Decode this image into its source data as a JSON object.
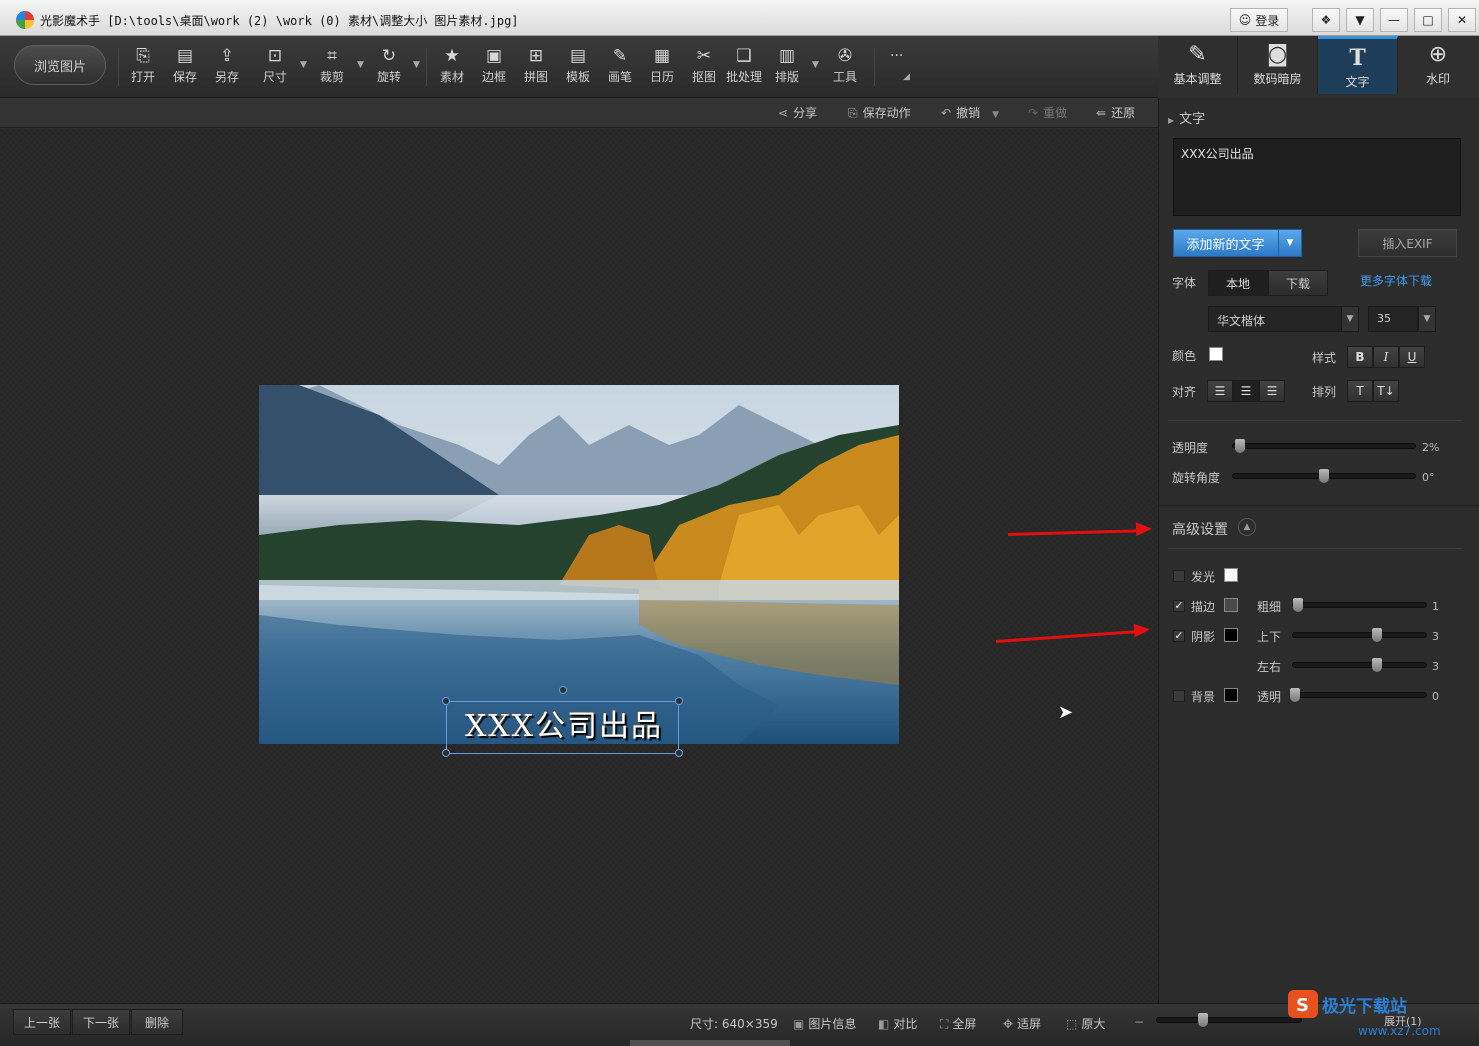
{
  "window": {
    "title": "光影魔术手 [D:\\tools\\桌面\\work (2) \\work (0) 素材\\调整大小 图片素材.jpg]",
    "login_label": "登录",
    "controls": [
      "❓",
      "▼",
      "—",
      "□",
      "✕"
    ]
  },
  "toolbar": {
    "browse_label": "浏览图片",
    "tools": [
      {
        "label": "打开",
        "icon": "open-icon"
      },
      {
        "label": "保存",
        "icon": "save-icon"
      },
      {
        "label": "另存",
        "icon": "save-as-icon"
      },
      {
        "label": "尺寸",
        "icon": "resize-icon"
      },
      {
        "label": "裁剪",
        "icon": "crop-icon"
      },
      {
        "label": "旋转",
        "icon": "rotate-icon"
      },
      {
        "label": "素材",
        "icon": "material-icon"
      },
      {
        "label": "边框",
        "icon": "border-icon"
      },
      {
        "label": "拼图",
        "icon": "collage-icon"
      },
      {
        "label": "模板",
        "icon": "template-icon"
      },
      {
        "label": "画笔",
        "icon": "brush-icon"
      },
      {
        "label": "日历",
        "icon": "calendar-icon"
      },
      {
        "label": "抠图",
        "icon": "cutout-icon"
      },
      {
        "label": "批处理",
        "icon": "batch-icon"
      },
      {
        "label": "排版",
        "icon": "layout-icon"
      },
      {
        "label": "工具",
        "icon": "tools-icon"
      }
    ],
    "more_label": "..."
  },
  "right_tabs": [
    {
      "label": "基本调整",
      "icon": "basic-adjust-icon"
    },
    {
      "label": "数码暗房",
      "icon": "darkroom-icon"
    },
    {
      "label": "文字",
      "icon": "text-tool-icon"
    },
    {
      "label": "水印",
      "icon": "watermark-icon"
    }
  ],
  "actions": {
    "share": "分享",
    "save_action": "保存动作",
    "undo": "撤销",
    "redo": "重做",
    "restore": "还原"
  },
  "canvas": {
    "overlay_text": "XXX公司出品"
  },
  "text_panel": {
    "section_title": "文字",
    "text_value": "XXX公司出品",
    "add_button": "添加新的文字",
    "insert_exif": "插入EXIF",
    "font_label": "字体",
    "font_tab_local": "本地",
    "font_tab_download": "下载",
    "more_fonts_link": "更多字体下载",
    "font_name": "华文楷体",
    "font_size": "35",
    "color_label": "颜色",
    "style_label": "样式",
    "style_bold": "B",
    "style_italic": "I",
    "style_underline": "U",
    "align_label": "对齐",
    "arrange_label": "排列",
    "opacity_label": "透明度",
    "opacity_value": "2%",
    "opacity_level": 0.02,
    "rotation_label": "旋转角度",
    "rotation_value": "0°",
    "rotation_level": 0.5,
    "color_value": "#ffffff"
  },
  "advanced": {
    "title": "高级设置",
    "glow_label": "发光",
    "glow_checked": false,
    "glow_color": "#ffffff",
    "stroke_label": "描边",
    "stroke_checked": true,
    "stroke_color": "#4a4a4a",
    "thickness_label": "粗细",
    "thickness_value": "1",
    "shadow_label": "阴影",
    "shadow_checked": true,
    "shadow_color": "#000000",
    "updown_label": "上下",
    "updown_value": "3",
    "leftright_label": "左右",
    "leftright_value": "3",
    "background_label": "背景",
    "background_checked": false,
    "background_color": "#000000",
    "transparency_label": "透明",
    "transparency_value": "0"
  },
  "bottom": {
    "prev": "上一张",
    "next": "下一张",
    "delete": "删除",
    "size_info": "尺寸: 640×359",
    "image_info": "图片信息",
    "compare": "对比",
    "fullscreen": "全屏",
    "fit": "适屏",
    "original": "原大",
    "zoom_minus": "−",
    "expand": "展开(1)"
  },
  "watermark": {
    "text": "极光下载站",
    "url": "www.xz7.com"
  }
}
